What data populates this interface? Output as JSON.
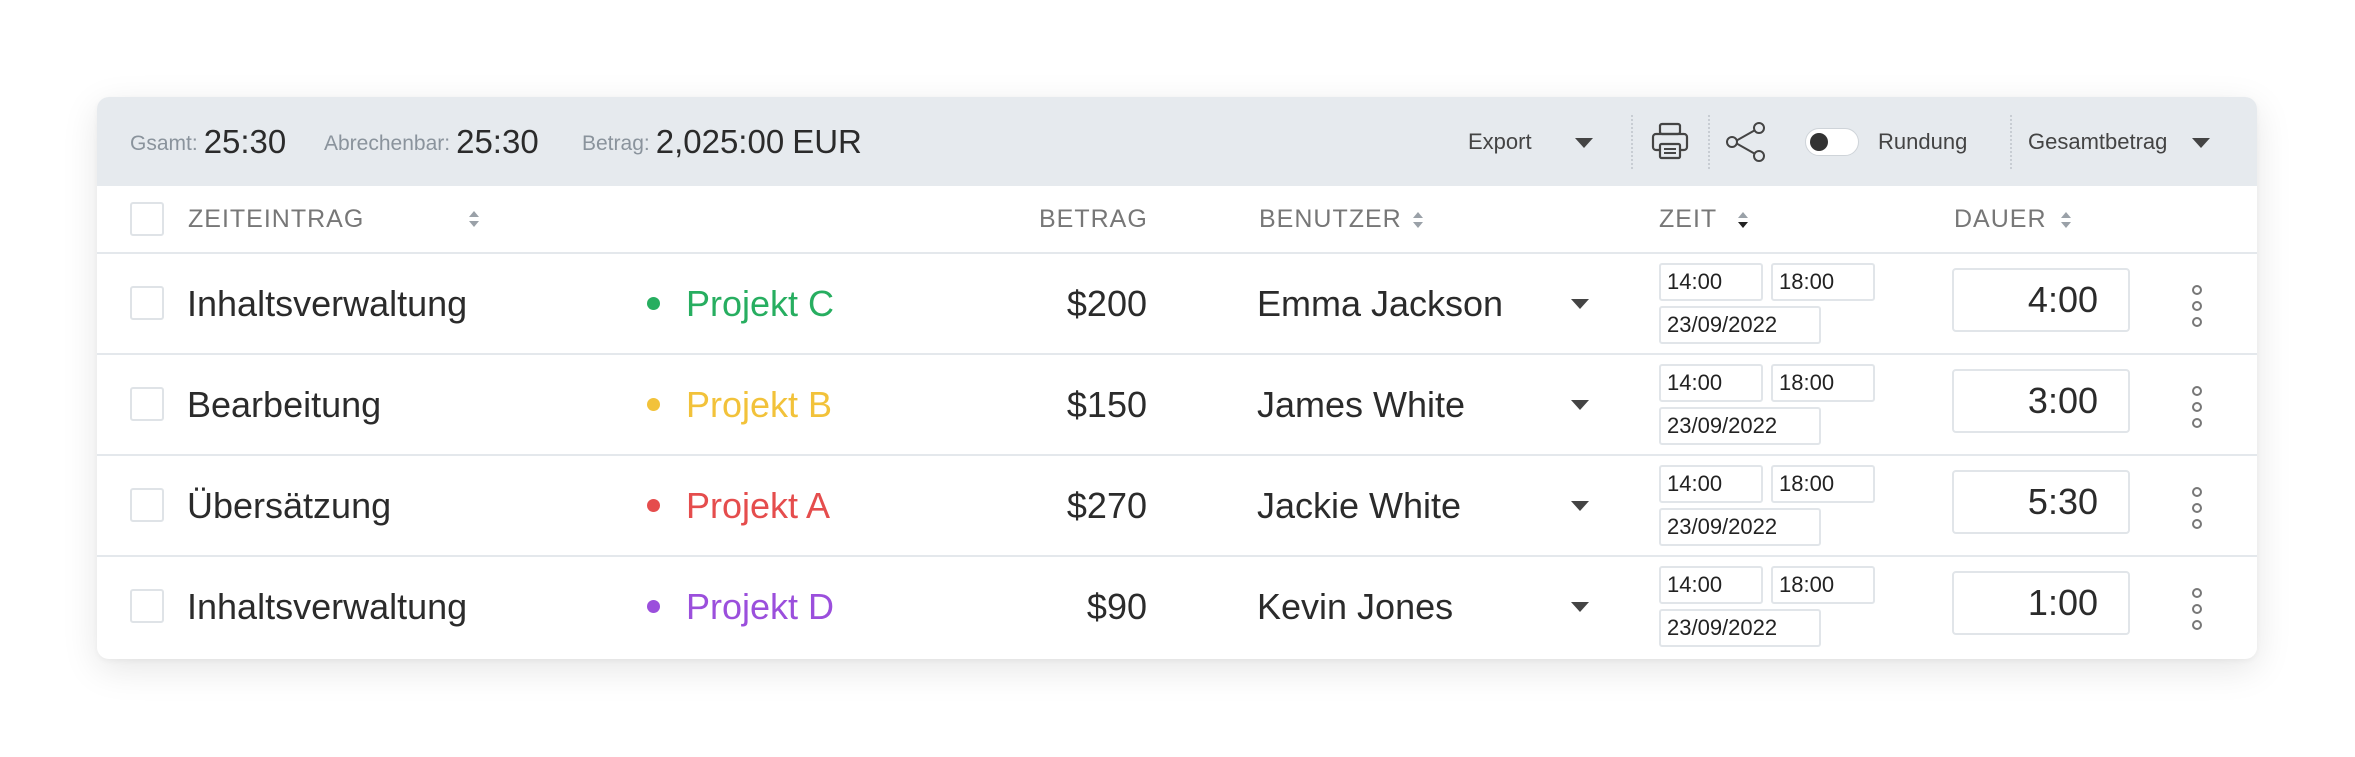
{
  "summary": {
    "total_label": "Gsamt:",
    "total_value": "25:30",
    "billable_label": "Abrechenbar:",
    "billable_value": "25:30",
    "amount_label": "Betrag:",
    "amount_value": "2,025:00",
    "amount_currency": "EUR"
  },
  "toolbar": {
    "export_label": "Export",
    "rounding_label": "Rundung",
    "rounding_enabled": false,
    "total_select_label": "Gesamtbetrag",
    "icons": [
      "printer-icon",
      "share-icon"
    ]
  },
  "table": {
    "columns": {
      "entry": "ZEITEINTRAG",
      "amount": "BETRAG",
      "user": "BENUTZER",
      "time": "ZEIT",
      "duration": "DAUER"
    },
    "rows": [
      {
        "description": "Inhaltsverwaltung",
        "project": "Projekt C",
        "project_color": "#27ae60",
        "amount": "$200",
        "user": "Emma Jackson",
        "start": "14:00",
        "end": "18:00",
        "date": "23/09/2022",
        "duration": "4:00"
      },
      {
        "description": "Bearbeitung",
        "project": "Projekt B",
        "project_color": "#f2c23a",
        "amount": "$150",
        "user": "James White",
        "start": "14:00",
        "end": "18:00",
        "date": "23/09/2022",
        "duration": "3:00"
      },
      {
        "description": "Übersätzung",
        "project": "Projekt A",
        "project_color": "#e54d4d",
        "amount": "$270",
        "user": "Jackie White",
        "start": "14:00",
        "end": "18:00",
        "date": "23/09/2022",
        "duration": "5:30"
      },
      {
        "description": "Inhaltsverwaltung",
        "project": "Projekt D",
        "project_color": "#9b4fdc",
        "amount": "$90",
        "user": "Kevin Jones",
        "start": "14:00",
        "end": "18:00",
        "date": "23/09/2022",
        "duration": "1:00"
      }
    ]
  }
}
